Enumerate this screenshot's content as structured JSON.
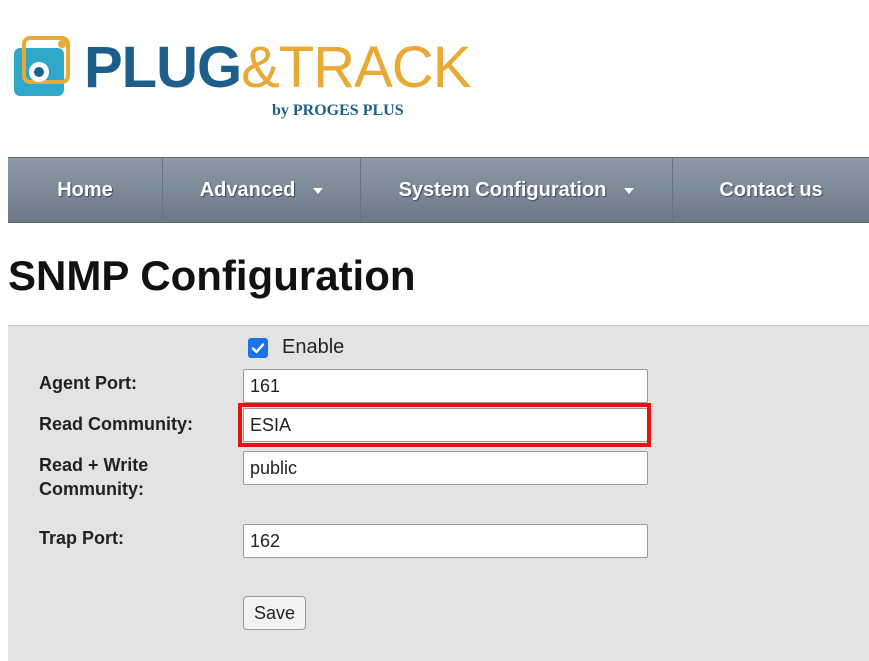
{
  "logo": {
    "brand_part1": "PLUG",
    "brand_part2": "&TRACK",
    "byline": "by PROGES PLUS",
    "colors": {
      "blue": "#1d5f8a",
      "orange": "#e8a935",
      "teal": "#2fa8c9"
    }
  },
  "nav": {
    "items": [
      {
        "label": "Home",
        "has_dropdown": false
      },
      {
        "label": "Advanced",
        "has_dropdown": true
      },
      {
        "label": "System Configuration",
        "has_dropdown": true
      },
      {
        "label": "Contact us",
        "has_dropdown": false
      }
    ]
  },
  "page": {
    "title": "SNMP Configuration"
  },
  "form": {
    "enable": {
      "label": "Enable",
      "checked": true
    },
    "agent_port": {
      "label": "Agent Port:",
      "value": "161"
    },
    "read_community": {
      "label": "Read Community:",
      "value": "ESIA",
      "highlight_color": "#e51212"
    },
    "read_write_community": {
      "label_line1": "Read + Write",
      "label_line2": "Community:",
      "value": "public"
    },
    "trap_port": {
      "label": "Trap Port:",
      "value": "162"
    },
    "save_label": "Save"
  }
}
